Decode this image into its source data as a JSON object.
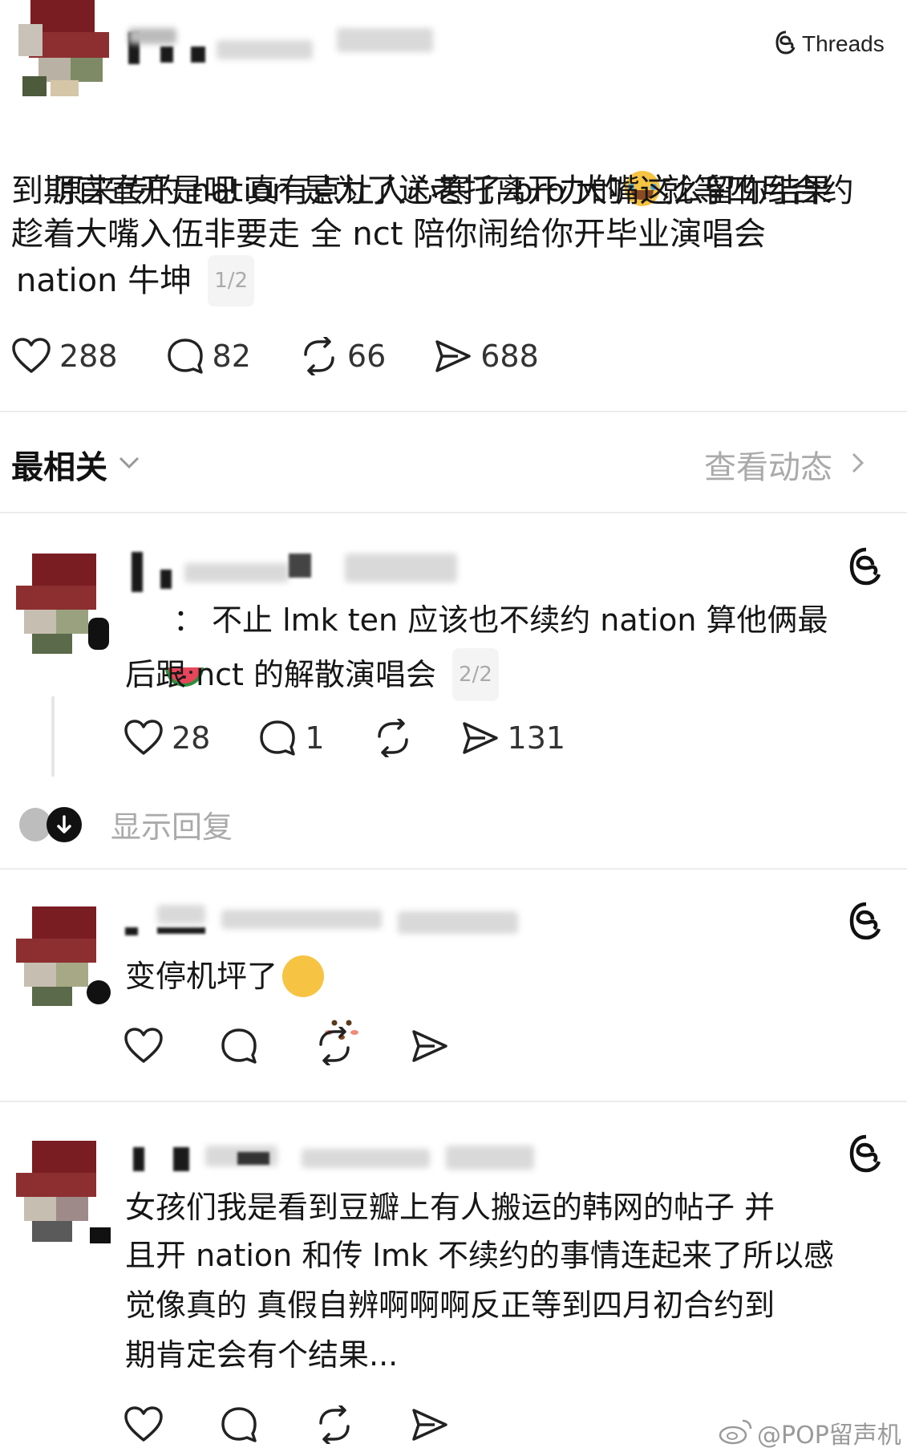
{
  "header": {
    "brand": "Threads"
  },
  "post": {
    "lines": [
      "原来传的 nation 是为了送老托离开办的",
      "到期官宣开是吧 真有点让人心寒了 bro 大嘴这么留你结果",
      "趁着大嘴入伍非要走 全 nct 陪你闹给你开毕业演唱会",
      "nation 牛坤"
    ],
    "line1_tail": "就等四月合约",
    "page_indicator": "1/2",
    "likes": "288",
    "comments": "82",
    "reposts": "66",
    "shares": "688"
  },
  "sort": {
    "label": "最相关",
    "view_activity": "查看动态"
  },
  "replies": [
    {
      "prefix": "：",
      "lines": [
        "不止 lmk ten 应该也不续约 nation 算他俩最",
        "后跟 nct 的解散演唱会"
      ],
      "page_indicator": "2/2",
      "likes": "28",
      "comments": "1",
      "shares": "131",
      "show_replies": "显示回复"
    },
    {
      "lines": [
        "变停机坪了"
      ]
    },
    {
      "lines": [
        "女孩们我是看到豆瓣上有人搬运的韩网的帖子 并",
        "且开 nation 和传 lmk 不续约的事情连起来了所以感",
        "觉像真的 真假自辨啊啊啊反正等到四月初合约到",
        "期肯定会有个结果..."
      ]
    }
  ],
  "watermark": "@POP留声机",
  "icons": [
    "threads-logo-icon",
    "heart-icon",
    "comment-icon",
    "repost-icon",
    "share-icon",
    "chevron-down-icon",
    "chevron-right-icon",
    "watermelon-emoji-icon",
    "laughing-emoji-icon",
    "flushed-emoji-icon",
    "weibo-icon"
  ]
}
